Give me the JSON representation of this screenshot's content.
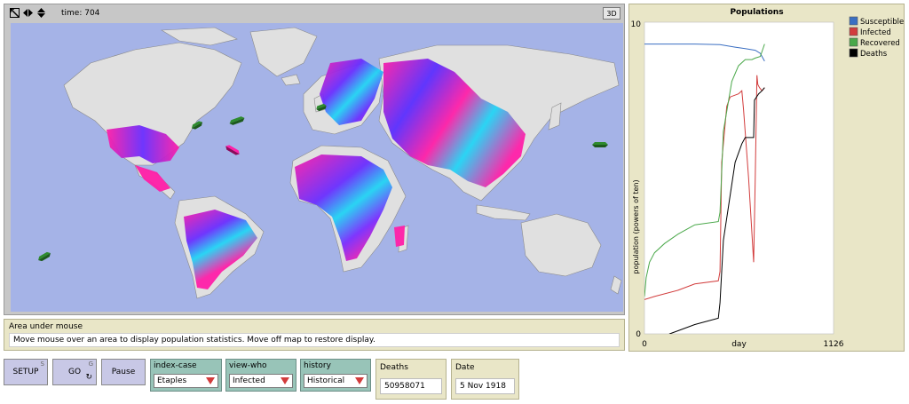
{
  "view": {
    "time_label": "time: 704",
    "btn_3d": "3D"
  },
  "mouse_area": {
    "title": "Area under mouse",
    "text": "Move mouse over an area to display population statistics. Move off map to restore display."
  },
  "buttons": {
    "setup": {
      "label": "SETUP",
      "key": "S"
    },
    "go": {
      "label": "GO",
      "key": "G",
      "loop_icon": "forever-icon"
    },
    "pause": {
      "label": "Pause"
    }
  },
  "choosers": {
    "index_case": {
      "title": "index-case",
      "value": "Etaples"
    },
    "view_who": {
      "title": "view-who",
      "value": "Infected"
    },
    "history": {
      "title": "history",
      "value": "Historical"
    }
  },
  "monitors": {
    "deaths": {
      "title": "Deaths",
      "value": "50958071"
    },
    "date": {
      "title": "Date",
      "value": "5 Nov 1918"
    }
  },
  "colors": {
    "widget_tan": "#e9e6c7",
    "button_lilac": "#c8c8e6",
    "chooser_green": "#98c4b8",
    "ocean": "#a5b3e7",
    "land": "#e0e0e0",
    "infect_magenta": "#ff1fa8",
    "infect_blue": "#6a2dff",
    "infect_cyan": "#21d4f5"
  },
  "chart_data": {
    "type": "line",
    "title": "Populations",
    "xlabel": "day",
    "ylabel": "population (powers of ten)",
    "xlim": [
      0,
      1126
    ],
    "ylim": [
      0,
      10
    ],
    "x_ticks": [
      "0",
      "1126"
    ],
    "y_ticks": [
      "0",
      "10"
    ],
    "legend_position": "top-right",
    "series": [
      {
        "name": "Susceptible",
        "color": "#3b6fc2",
        "points": [
          [
            0,
            9.3
          ],
          [
            150,
            9.3
          ],
          [
            300,
            9.3
          ],
          [
            450,
            9.28
          ],
          [
            540,
            9.2
          ],
          [
            600,
            9.15
          ],
          [
            660,
            9.1
          ],
          [
            690,
            9.0
          ],
          [
            715,
            8.75
          ]
        ]
      },
      {
        "name": "Infected",
        "color": "#d23c3c",
        "points": [
          [
            0,
            1.1
          ],
          [
            60,
            1.2
          ],
          [
            200,
            1.4
          ],
          [
            300,
            1.6
          ],
          [
            440,
            1.7
          ],
          [
            450,
            2.0
          ],
          [
            460,
            5.5
          ],
          [
            490,
            7.3
          ],
          [
            510,
            7.6
          ],
          [
            560,
            7.7
          ],
          [
            580,
            7.8
          ],
          [
            590,
            7.2
          ],
          [
            620,
            5.0
          ],
          [
            650,
            2.3
          ],
          [
            660,
            5.0
          ],
          [
            670,
            8.3
          ],
          [
            675,
            8.0
          ],
          [
            685,
            7.9
          ],
          [
            700,
            7.8
          ],
          [
            715,
            7.9
          ]
        ]
      },
      {
        "name": "Recovered",
        "color": "#4aa84a",
        "points": [
          [
            0,
            1.2
          ],
          [
            10,
            1.8
          ],
          [
            30,
            2.3
          ],
          [
            60,
            2.6
          ],
          [
            120,
            2.9
          ],
          [
            200,
            3.2
          ],
          [
            300,
            3.5
          ],
          [
            440,
            3.6
          ],
          [
            450,
            3.9
          ],
          [
            470,
            6.5
          ],
          [
            520,
            8.1
          ],
          [
            560,
            8.6
          ],
          [
            600,
            8.8
          ],
          [
            640,
            8.8
          ],
          [
            660,
            8.85
          ],
          [
            690,
            8.9
          ],
          [
            715,
            9.3
          ]
        ]
      },
      {
        "name": "Deaths",
        "color": "#000000",
        "points": [
          [
            0,
            -0.6
          ],
          [
            100,
            -0.2
          ],
          [
            150,
            0.0
          ],
          [
            300,
            0.3
          ],
          [
            440,
            0.5
          ],
          [
            450,
            1.0
          ],
          [
            470,
            3.0
          ],
          [
            540,
            5.5
          ],
          [
            580,
            6.1
          ],
          [
            600,
            6.3
          ],
          [
            650,
            6.3
          ],
          [
            655,
            7.5
          ],
          [
            680,
            7.7
          ],
          [
            700,
            7.8
          ],
          [
            715,
            7.9
          ]
        ]
      }
    ]
  }
}
